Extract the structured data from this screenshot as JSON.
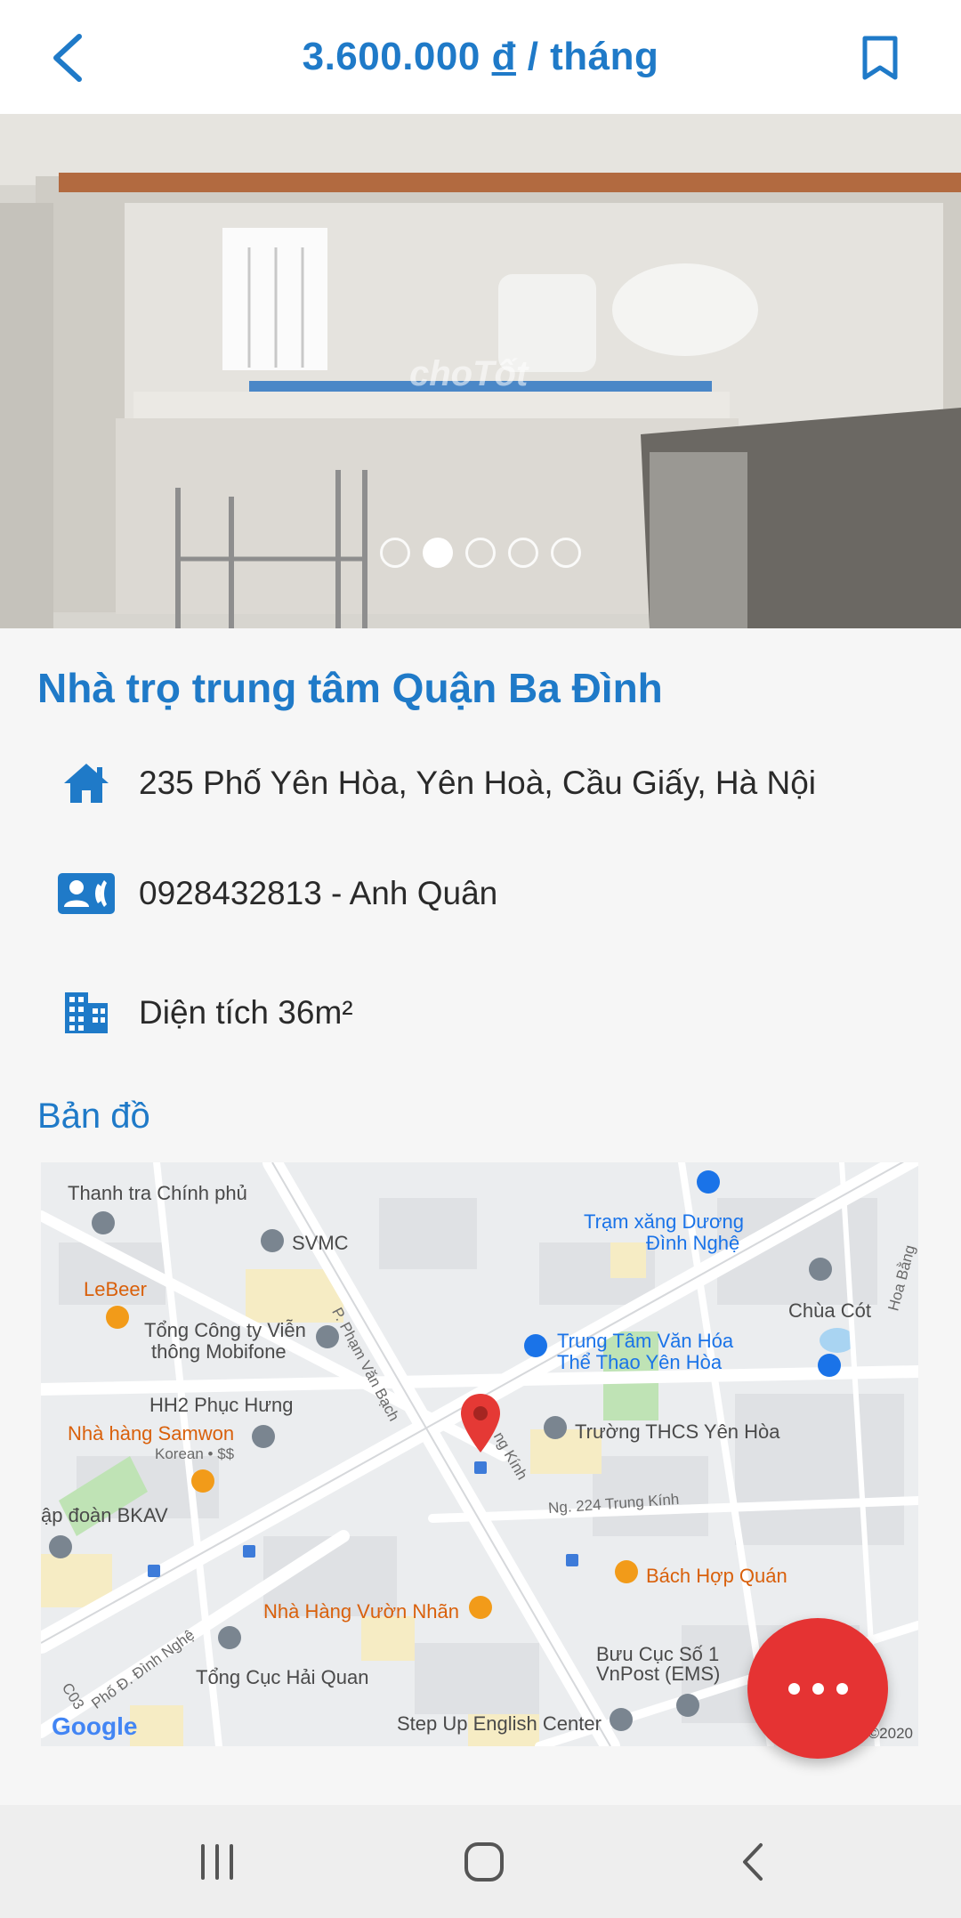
{
  "header": {
    "price_amount": "3.600.000",
    "currency": "đ",
    "price_unit": "/ tháng"
  },
  "photo": {
    "watermark": "choTốt",
    "slide_count": 5,
    "active_slide": 2
  },
  "listing": {
    "title": "Nhà trọ trung tâm Quận Ba Đình",
    "address": "235 Phố Yên Hòa, Yên Hoà, Cầu Giấy, Hà Nội",
    "contact": "0928432813 - Anh Quân",
    "area": "Diện tích 36m²"
  },
  "map_section": {
    "title": "Bản đồ",
    "labels": {
      "thanh_tra": "Thanh tra Chính phủ",
      "svmc": "SVMC",
      "lebeer": "LeBeer",
      "mobifone_1": "Tổng Công ty Viễn",
      "mobifone_2": "thông Mobifone",
      "hh2": "HH2 Phục Hưng",
      "samwon": "Nhà hàng Samwon",
      "samwon_sub": "Korean • $$",
      "bkav": "ập đoàn BKAV",
      "tram_xang_1": "Trạm xăng Dương",
      "tram_xang_2": "Đình Nghệ",
      "chua_cot": "Chùa Cót",
      "hoa_bang": "Hoa Bằng",
      "trung_tam_1": "Trung Tâm Văn Hóa",
      "trung_tam_2": "Thể Thao Yên Hòa",
      "truong": "Trường THCS Yên Hòa",
      "pham_van_bach": "P. Phạm Văn Bạch",
      "trung_kinh": "ng Kính",
      "ng224": "Ng. 224 Trung Kính",
      "bach_hop": "Bách Hợp Quán",
      "vuon_nhan": "Nhà Hàng Vườn Nhãn",
      "hai_quan": "Tổng Cục Hải Quan",
      "dinh_nghe": "Phố Đ. Đình Nghệ",
      "c03": "C03",
      "buu_cuc_1": "Bưu Cục Số 1",
      "buu_cuc_2": "VnPost (EMS)",
      "step_up": "Step Up English Center"
    },
    "google": "Google",
    "copyright": "©2020"
  },
  "colors": {
    "accent": "#1f7ac8",
    "fab": "#e53333",
    "marker": "#e53935"
  },
  "icons": [
    "back-icon",
    "bookmark-icon",
    "home-icon",
    "contact-card-icon",
    "building-icon",
    "more-icon",
    "recents-icon",
    "home-nav-icon",
    "back-nav-icon"
  ]
}
